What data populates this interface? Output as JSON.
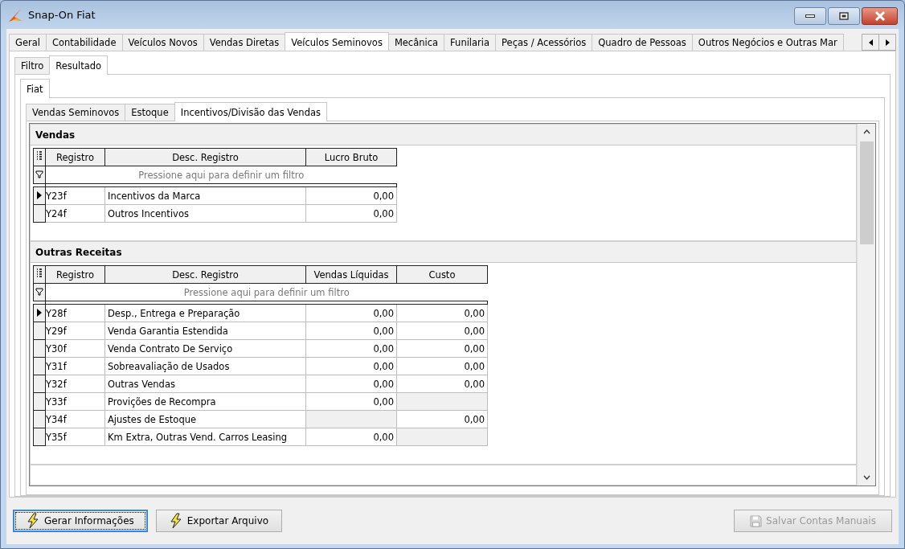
{
  "window": {
    "title": "Snap-On Fiat"
  },
  "tabs": [
    {
      "label": "Geral",
      "selected": false
    },
    {
      "label": "Contabilidade",
      "selected": false
    },
    {
      "label": "Veículos Novos",
      "selected": false
    },
    {
      "label": "Vendas Diretas",
      "selected": false
    },
    {
      "label": "Veículos Seminovos",
      "selected": true
    },
    {
      "label": "Mecânica",
      "selected": false
    },
    {
      "label": "Funilaria",
      "selected": false
    },
    {
      "label": "Peças / Acessórios",
      "selected": false
    },
    {
      "label": "Quadro de Pessoas",
      "selected": false
    },
    {
      "label": "Outros Negócios e Outras Mar",
      "selected": false
    }
  ],
  "sub_tabs": [
    {
      "label": "Filtro",
      "selected": false
    },
    {
      "label": "Resultado",
      "selected": true
    }
  ],
  "brand_tabs": [
    {
      "label": "Fiat",
      "selected": true
    }
  ],
  "section_tabs": [
    {
      "label": "Vendas Seminovos",
      "selected": false
    },
    {
      "label": "Estoque",
      "selected": false
    },
    {
      "label": "Incentivos/Divisão das Vendas",
      "selected": true
    }
  ],
  "sections": [
    {
      "title": "Vendas",
      "columns": [
        "Registro",
        "Desc. Registro",
        "Lucro Bruto"
      ],
      "filter_placeholder": "Pressione aqui para definir um filtro",
      "rows": [
        {
          "registro": "Y23f",
          "descricao": "Incentivos da Marca",
          "values": [
            {
              "text": "0,00",
              "editable": true
            }
          ],
          "selected": true
        },
        {
          "registro": "Y24f",
          "descricao": "Outros Incentivos",
          "values": [
            {
              "text": "0,00",
              "editable": true
            }
          ],
          "selected": false
        }
      ]
    },
    {
      "title": "Outras Receitas",
      "columns": [
        "Registro",
        "Desc. Registro",
        "Vendas Líquidas",
        "Custo"
      ],
      "filter_placeholder": "Pressione aqui para definir um filtro",
      "rows": [
        {
          "registro": "Y28f",
          "descricao": "Desp., Entrega e Preparação",
          "values": [
            {
              "text": "0,00",
              "editable": true
            },
            {
              "text": "0,00",
              "editable": true
            }
          ],
          "selected": true
        },
        {
          "registro": "Y29f",
          "descricao": "Venda Garantia Estendida",
          "values": [
            {
              "text": "0,00",
              "editable": true
            },
            {
              "text": "0,00",
              "editable": true
            }
          ],
          "selected": false
        },
        {
          "registro": "Y30f",
          "descricao": "Venda Contrato De Serviço",
          "values": [
            {
              "text": "0,00",
              "editable": true
            },
            {
              "text": "0,00",
              "editable": true
            }
          ],
          "selected": false
        },
        {
          "registro": "Y31f",
          "descricao": "Sobreavaliação de Usados",
          "values": [
            {
              "text": "0,00",
              "editable": true
            },
            {
              "text": "0,00",
              "editable": true
            }
          ],
          "selected": false
        },
        {
          "registro": "Y32f",
          "descricao": "Outras Vendas",
          "values": [
            {
              "text": "0,00",
              "editable": true
            },
            {
              "text": "0,00",
              "editable": true
            }
          ],
          "selected": false
        },
        {
          "registro": "Y33f",
          "descricao": "Provições de Recompra",
          "values": [
            {
              "text": "0,00",
              "editable": true
            },
            {
              "editable": false
            }
          ],
          "selected": false
        },
        {
          "registro": "Y34f",
          "descricao": "Ajustes de Estoque",
          "values": [
            {
              "editable": false
            },
            {
              "text": "0,00",
              "editable": true
            }
          ],
          "selected": false
        },
        {
          "registro": "Y35f",
          "descricao": "Km Extra, Outras Vend. Carros Leasing",
          "values": [
            {
              "text": "0,00",
              "editable": true
            },
            {
              "editable": false
            }
          ],
          "selected": false
        }
      ]
    }
  ],
  "buttons": [
    {
      "label": "Gerar Informações",
      "kind": "lightning",
      "focused": true,
      "disabled": false
    },
    {
      "label": "Exportar Arquivo",
      "kind": "lightning",
      "focused": false,
      "disabled": false
    },
    {
      "label": "Salvar Contas Manuais",
      "kind": "save",
      "focused": false,
      "disabled": true
    }
  ]
}
